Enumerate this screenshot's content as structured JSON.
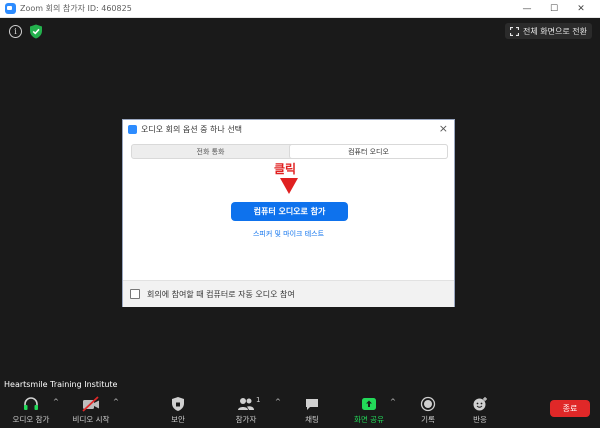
{
  "window": {
    "title": "Zoom 회의 참가자 ID: 460825",
    "minimize": "—",
    "maximize": "☐",
    "close": "✕"
  },
  "meeting": {
    "info_label": "i",
    "fullscreen_label": "전체 화면으로 전환",
    "participant_name": "Heartsmile Training Institute"
  },
  "dialog": {
    "title": "오디오 회의 옵션 중 하나 선택",
    "close": "×",
    "tabs": [
      {
        "label": "전화 통화",
        "active": false
      },
      {
        "label": "컴퓨터 오디오",
        "active": true
      }
    ],
    "annotation": "클릭",
    "join_button": "컴퓨터 오디오로 참가",
    "test_link": "스피커 및 마이크 테스트",
    "auto_join_checkbox": {
      "label": "회의에 참여할 때 컴퓨터로 자동 오디오 참여",
      "checked": false
    }
  },
  "toolbar": {
    "items": [
      {
        "label": "오디오 참가",
        "icon": "headphones-icon"
      },
      {
        "label": "비디오 시작",
        "icon": "video-off-icon"
      },
      {
        "label": "보안",
        "icon": "shield-icon"
      },
      {
        "label": "참가자",
        "icon": "participants-icon",
        "count": "1"
      },
      {
        "label": "채팅",
        "icon": "chat-icon"
      },
      {
        "label": "화면 공유",
        "icon": "share-screen-icon",
        "color": "#23d959"
      },
      {
        "label": "기록",
        "icon": "record-icon"
      },
      {
        "label": "반응",
        "icon": "reaction-icon"
      }
    ],
    "end_button": "종료",
    "caret": "^"
  },
  "colors": {
    "accent": "#0e72ed",
    "annotation_red": "#e02020",
    "end_red": "#e02828",
    "share_green": "#23d959",
    "meeting_bg": "#1a1a1a"
  }
}
